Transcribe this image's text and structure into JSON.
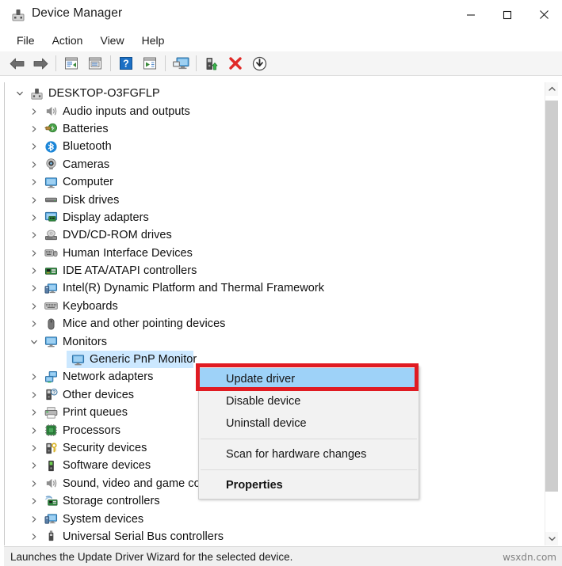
{
  "window": {
    "title": "Device Manager",
    "icon": "device-manager-icon",
    "caption_buttons": [
      {
        "name": "minimize-button",
        "glyph": "minimize"
      },
      {
        "name": "maximize-button",
        "glyph": "maximize"
      },
      {
        "name": "close-button",
        "glyph": "close"
      }
    ]
  },
  "menubar": {
    "items": [
      {
        "label": "File"
      },
      {
        "label": "Action"
      },
      {
        "label": "View"
      },
      {
        "label": "Help"
      }
    ]
  },
  "toolbar": {
    "buttons": [
      {
        "name": "back-button",
        "icon": "back-arrow-icon"
      },
      {
        "name": "forward-button",
        "icon": "forward-arrow-icon"
      },
      {
        "name": "up-one-level-button",
        "icon": "window-left-icon"
      },
      {
        "name": "properties-button",
        "icon": "properties-window-icon"
      },
      {
        "name": "help-button",
        "icon": "question-mark-icon"
      },
      {
        "name": "show-hide-console-tree-button",
        "icon": "window-play-icon"
      },
      {
        "name": "scan-hardware-changes-button",
        "icon": "monitor-scan-icon"
      },
      {
        "name": "update-driver-button",
        "icon": "update-driver-icon"
      },
      {
        "name": "uninstall-device-button",
        "icon": "red-x-icon"
      },
      {
        "name": "disable-device-button",
        "icon": "down-arrow-circle-icon"
      }
    ]
  },
  "tree": {
    "root": {
      "label": "DESKTOP-O3FGFLP",
      "icon": "computer-root-icon",
      "expanded": true
    },
    "items": [
      {
        "label": "Audio inputs and outputs",
        "icon": "speaker-icon",
        "expanded": false,
        "level": 1
      },
      {
        "label": "Batteries",
        "icon": "battery-icon",
        "expanded": false,
        "level": 1
      },
      {
        "label": "Bluetooth",
        "icon": "bluetooth-icon",
        "expanded": false,
        "level": 1
      },
      {
        "label": "Cameras",
        "icon": "camera-icon",
        "expanded": false,
        "level": 1
      },
      {
        "label": "Computer",
        "icon": "monitor-icon",
        "expanded": false,
        "level": 1
      },
      {
        "label": "Disk drives",
        "icon": "disk-drive-icon",
        "expanded": false,
        "level": 1
      },
      {
        "label": "Display adapters",
        "icon": "display-adapter-icon",
        "expanded": false,
        "level": 1
      },
      {
        "label": "DVD/CD-ROM drives",
        "icon": "dvd-drive-icon",
        "expanded": false,
        "level": 1
      },
      {
        "label": "Human Interface Devices",
        "icon": "hid-icon",
        "expanded": false,
        "level": 1
      },
      {
        "label": "IDE ATA/ATAPI controllers",
        "icon": "ide-controller-icon",
        "expanded": false,
        "level": 1
      },
      {
        "label": "Intel(R) Dynamic Platform and Thermal Framework",
        "icon": "system-device-icon",
        "expanded": false,
        "level": 1
      },
      {
        "label": "Keyboards",
        "icon": "keyboard-icon",
        "expanded": false,
        "level": 1
      },
      {
        "label": "Mice and other pointing devices",
        "icon": "mouse-icon",
        "expanded": false,
        "level": 1
      },
      {
        "label": "Monitors",
        "icon": "monitor-icon",
        "expanded": true,
        "level": 1
      },
      {
        "label": "Generic PnP Monitor",
        "icon": "monitor-icon",
        "expanded": null,
        "level": 2,
        "selected": true
      },
      {
        "label": "Network adapters",
        "icon": "network-adapter-icon",
        "expanded": false,
        "level": 1
      },
      {
        "label": "Other devices",
        "icon": "other-device-icon",
        "expanded": false,
        "level": 1
      },
      {
        "label": "Print queues",
        "icon": "printer-icon",
        "expanded": false,
        "level": 1
      },
      {
        "label": "Processors",
        "icon": "processor-icon",
        "expanded": false,
        "level": 1
      },
      {
        "label": "Security devices",
        "icon": "security-device-icon",
        "expanded": false,
        "level": 1
      },
      {
        "label": "Software devices",
        "icon": "software-device-icon",
        "expanded": false,
        "level": 1
      },
      {
        "label": "Sound, video and game controllers",
        "icon": "speaker-icon",
        "expanded": false,
        "level": 1
      },
      {
        "label": "Storage controllers",
        "icon": "storage-controller-icon",
        "expanded": false,
        "level": 1
      },
      {
        "label": "System devices",
        "icon": "system-device-icon",
        "expanded": false,
        "level": 1
      },
      {
        "label": "Universal Serial Bus controllers",
        "icon": "usb-icon",
        "expanded": false,
        "level": 1
      }
    ]
  },
  "context_menu": {
    "items": [
      {
        "label": "Update driver",
        "highlighted": true,
        "bold": false
      },
      {
        "label": "Disable device",
        "highlighted": false,
        "bold": false
      },
      {
        "label": "Uninstall device",
        "highlighted": false,
        "bold": false
      },
      {
        "separator": true
      },
      {
        "label": "Scan for hardware changes",
        "highlighted": false,
        "bold": false
      },
      {
        "separator": true
      },
      {
        "label": "Properties",
        "highlighted": false,
        "bold": true
      }
    ]
  },
  "statusbar": {
    "text": "Launches the Update Driver Wizard for the selected device."
  },
  "watermark": {
    "text": "wsxdn.com"
  },
  "colors": {
    "highlight_blue": "#9ed2f8",
    "selection_blue": "#cce8ff",
    "annotation_red": "#e01b22",
    "toolbar_bg": "#f5f5f5",
    "menu_bg": "#f2f2f2",
    "statusbar_bg": "#f0f0f0"
  }
}
